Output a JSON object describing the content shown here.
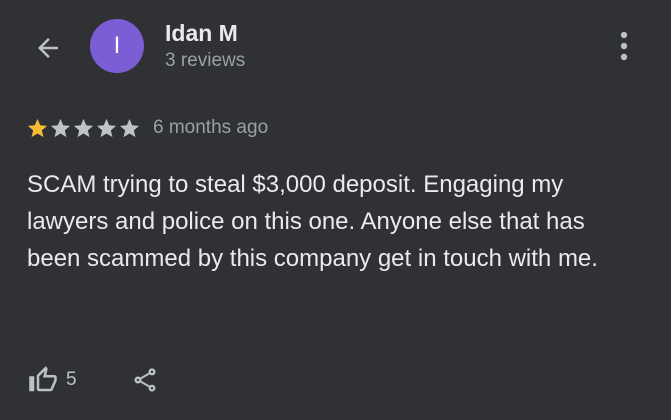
{
  "colors": {
    "background": "#303134",
    "avatar": "#7b5ed6",
    "star_filled": "#f9bc34",
    "star_empty": "#bfc2c7",
    "primary_text": "#e8eaed",
    "secondary_text": "#9aa0a6",
    "icon": "#bdc1c6"
  },
  "header": {
    "back_icon": "arrow-back-icon",
    "avatar_initial": "I",
    "user_name": "Idan M",
    "review_count": "3 reviews",
    "more_icon": "more-vert-icon"
  },
  "review": {
    "rating": 1,
    "max_rating": 5,
    "time_ago": "6 months ago",
    "text": "SCAM trying to steal $3,000 deposit. Engaging my lawyers and police on this one. Anyone else that has been scammed by this company get in touch with me."
  },
  "actions": {
    "like_icon": "thumb-up-icon",
    "like_count": "5",
    "share_icon": "share-icon"
  }
}
